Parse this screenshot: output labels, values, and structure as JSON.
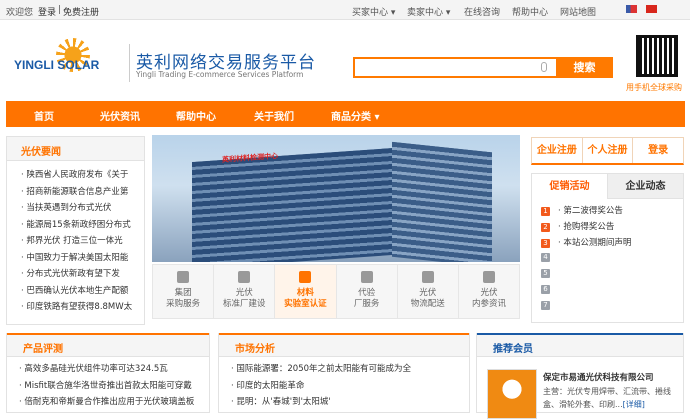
{
  "topbar": {
    "welcome": "欢迎您",
    "login": "登录",
    "register": "免费注册",
    "buyer": "买家中心 ▾",
    "seller": "卖家中心 ▾",
    "consult": "在线咨询",
    "help": "帮助中心",
    "sitemap": "网站地图"
  },
  "header": {
    "logo_text": "YINGLI SOLAR",
    "title": "英利网络交易服务平台",
    "subtitle": "Yingli Trading E-commerce Services Platform",
    "search_placeholder": "",
    "search_button": "搜索",
    "qr_text": "用手机全球采购"
  },
  "nav": [
    "首页",
    "光伏资讯",
    "帮助中心",
    "关于我们",
    "商品分类 ▾"
  ],
  "news": {
    "title": "光伏要闻",
    "items": [
      "· 陕西省人民政府发布《关于",
      "· 招商新能源联合信息产业第",
      "· 当扶英遇到分布式光伏",
      "· 能源局15条新政纾困分布式",
      "· 邦界光伏 打造三位一体光",
      "· 中国致力于解决美国太阳能",
      "· 分布式光伏新政有望下发",
      "· 巴西确认光伏本地生产配额",
      "· 印度铁路有望获得8.8MW太"
    ]
  },
  "banner": {
    "sign": "英利材料检测中心"
  },
  "services": [
    {
      "l1": "集团",
      "l2": "采购服务"
    },
    {
      "l1": "光伏",
      "l2": "标准厂建设"
    },
    {
      "l1": "材料",
      "l2": "实验室认证"
    },
    {
      "l1": "代验",
      "l2": "厂服务"
    },
    {
      "l1": "光伏",
      "l2": "物流配送"
    },
    {
      "l1": "光伏",
      "l2": "内参资讯"
    }
  ],
  "account": {
    "company_reg": "企业注册",
    "personal_reg": "个人注册",
    "login": "登录"
  },
  "promo": {
    "tab_active": "促销活动",
    "tab_other": "企业动态",
    "items": [
      "· 第二波得奖公告",
      "· 抢购得奖公告",
      "· 本站公测期间声明",
      "",
      "",
      "",
      ""
    ]
  },
  "product_review": {
    "title": "产品评测",
    "items": [
      "· 高效多晶硅光伏组件功率可达324.5瓦",
      "· Misfit联合施华洛世奇推出首款太阳能可穿戴",
      "· 倍耐克和帝斯曼合作推出应用于光伏玻璃盖板"
    ]
  },
  "market": {
    "title": "市场分析",
    "items": [
      "· 国际能源署：2050年之前太阳能有可能成为全",
      "· 印度的太阳能革命",
      "· 昆明：从'春城'到'太阳城'"
    ]
  },
  "member": {
    "title": "推荐会员",
    "company": "保定市易通光伏科技有限公司",
    "desc": "主营：光伏专用焊带、汇流带、捲线盒、滑轮外套、印刷...",
    "more": "[详细]"
  },
  "colors": {
    "accent": "#ff7300",
    "blue": "#1a5aa6"
  }
}
